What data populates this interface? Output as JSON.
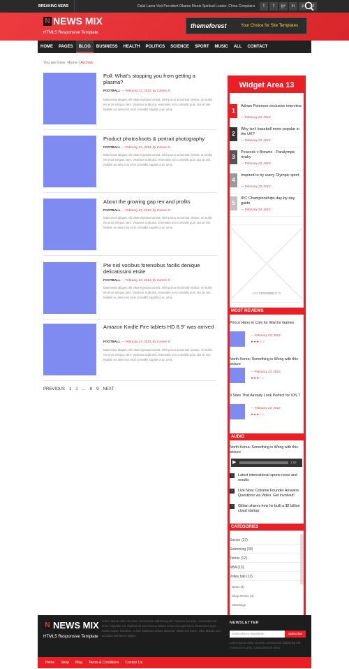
{
  "topbar": {
    "breaking_label": "BREAKING NEWS",
    "ticker": "Dalai Lama Visit President Obama Meets Spiritual Leader, China Complains",
    "social_icons": [
      "t",
      "f",
      "g+",
      "in",
      "p",
      "yt"
    ]
  },
  "header": {
    "logo_mark": "N",
    "logo_name": "NEWS MIX",
    "tagline": "HTML5 Responsive Template",
    "banner_brand": "themeforest",
    "banner_text": "Your Choice for Site Templates"
  },
  "nav": {
    "items": [
      "HOME",
      "PAGES",
      "BLOG",
      "BUSINESS",
      "HEALTH",
      "POLITICS",
      "SCIENCE",
      "SPORT",
      "MUSIC",
      "ALL",
      "CONTACT"
    ],
    "active": "BLOG"
  },
  "breadcrumb": {
    "prefix": "You are here:",
    "home": "Home",
    "sep": "/",
    "current": "Archive"
  },
  "posts": [
    {
      "title": "Poll: What's stopping you from getting a plasma?",
      "category": "FOOTBALL",
      "date": "— February 23, 2013, by Careen N",
      "excerpt": "Maecenas aliquet, elit vitae egestas lacinia, nibh purus accumsan metus, ut mollis est eros tempus sem. Vivamus nulla dui, venenatis non convallis quis, dui sit nisi. Nullam eu ante non eros convallis sagittis a ac urna."
    },
    {
      "title": "Product photoshoots & portrait photography",
      "category": "FOOTBALL",
      "date": "— February 23, 2013, by Careen N",
      "excerpt": "Maecenas aliquet, elit vitae egestas lacinia, nibh purus accumsan metus, ut mollis est eros tempus sem. Vivamus nulla dui, venenatis non convallis quis, dui sit nisi. Nullam eu ante non eros convallis sagittis a ac urna."
    },
    {
      "title": "About the growing gap rev and profits",
      "category": "FOOTBALL",
      "date": "— February 23, 2013, by Careen N",
      "excerpt": "Maecenas aliquet, elit vitae egestas lacinia, nibh purus accumsan metus, ut mollis est eros tempus sem. Vivamus nulla dui, venenatis non convallis quis, dui sit nisi. Nullam eu ante non eros convallis sagittis a ac urna."
    },
    {
      "title": "Pte nisl vocibus forensibus facilis denique delicatissimi etsite",
      "category": "FOOTBALL",
      "date": "— February 23, 2013, by Careen N",
      "excerpt": "Maecenas aliquet, elit vitae egestas lacinia, nibh purus accumsan metus, ut mollis est eros tempus sem. Vivamus nulla dui, venenatis non convallis quis, dui sit nisi. Nullam eu ante non eros convallis sagittis a ac urna."
    },
    {
      "title": "Amazon Kindle Fire tablets HD 8.9\" was arrived",
      "category": "FOOTBALL",
      "date": "— February 23, 2013, by Careen N",
      "excerpt": "Maecenas aliquet, elit vitae egestas lacinia, nibh purus accumsan metus, ut mollis est eros tempus sem. Vivamus nulla dui, venenatis non convallis quis, dui sit nisi. Nullam eu ante non eros convallis sagittis a ac urna."
    }
  ],
  "pagination": {
    "prev": "PREVIOUS",
    "pages": [
      "1",
      "2",
      "...",
      "8",
      "9"
    ],
    "current": "2",
    "next": "NEXT"
  },
  "sidebar": {
    "widget_title": "Widget Area 13",
    "popular": [
      {
        "num": "1",
        "title": "Adrian Peterson exclusive interview",
        "date": "— February 23, 2013",
        "color": "#e82025"
      },
      {
        "num": "2",
        "title": "Why isn't baseball more popular in the UK?",
        "date": "— February 23, 2013",
        "color": "#333333"
      },
      {
        "num": "3",
        "title": "Peacock v Browne - Paralympic rivalry",
        "date": "— February 23, 2013",
        "color": "#555555"
      },
      {
        "num": "4",
        "title": "Inspired to try every Olympic sport",
        "date": "— February 23, 2013",
        "color": "#9a9a9a"
      },
      {
        "num": "5",
        "title": "IPC Championships day-by-day guide",
        "date": "— February 23, 2013",
        "color": "#c0c0c0"
      }
    ],
    "ad_line1": "ADVERTISEMENTS",
    "ad_line2": "300X300",
    "reviews_title": "MOST REVIEWS",
    "reviews": [
      {
        "title": "Prince Harry in Colo for Warrior Games",
        "date": "— February 23, 2013",
        "stars": "★★★☆☆"
      },
      {
        "title": "North Korea: Something is Wong with this picture",
        "date": "— February 23, 2013",
        "stars": "★★★☆☆"
      },
      {
        "title": "9 Sites That Already Look Perfect for iOS 7",
        "date": "— February 23, 2013",
        "stars": "★★★☆☆"
      }
    ],
    "audio_title": "AUDIO",
    "audio_track": "North Korea: Something is Wong with this picture",
    "audio_time": "1:52",
    "news": [
      "Latest international sports news and results",
      "Live Now: Cotvene Founder Answers Questions via Video. Get involved!",
      "Gillian shares how he built a $2 billion cloud startup"
    ],
    "categories_title": "CATEGORIES",
    "categories": [
      "Soccer (22)",
      "Swimming (30)",
      "Tennis (12)",
      "NBA (13)",
      "Volley ball (13)"
    ],
    "subcategories": [
      "News (3)",
      "Shop Tennis (4)",
      "Standings"
    ]
  },
  "footer": {
    "logo_mark": "N",
    "logo_name": "NEWS MIX",
    "tagline": "HTML5 Responsive Template",
    "about": "Lorem ipsum dolor sit amet, consectetur adipiscing elit. Vivamus leo ante, consectetur sit amet vulputate vel, dapibus sit amet lectus. Etiam varius dui eget lorem elementum eget mattis sapien interdum. In hac habitasse platea dictumst. Morbi sed lorem, vitae blandit arcu tincidunt sed lorem sapien.",
    "newsletter_title": "NEWSLETTER",
    "newsletter_placeholder": "Subscribe to newsletter",
    "subscribe_label": "Subscribe",
    "newsletter_text": "Lorem ipsum dolor sit amet, consectetur adipiscing elit. Vivamus leo ante, consectetur sit amet.",
    "links": [
      "Home",
      "Shop",
      "Blog",
      "Terms & Conditions",
      "Contact Us"
    ]
  }
}
